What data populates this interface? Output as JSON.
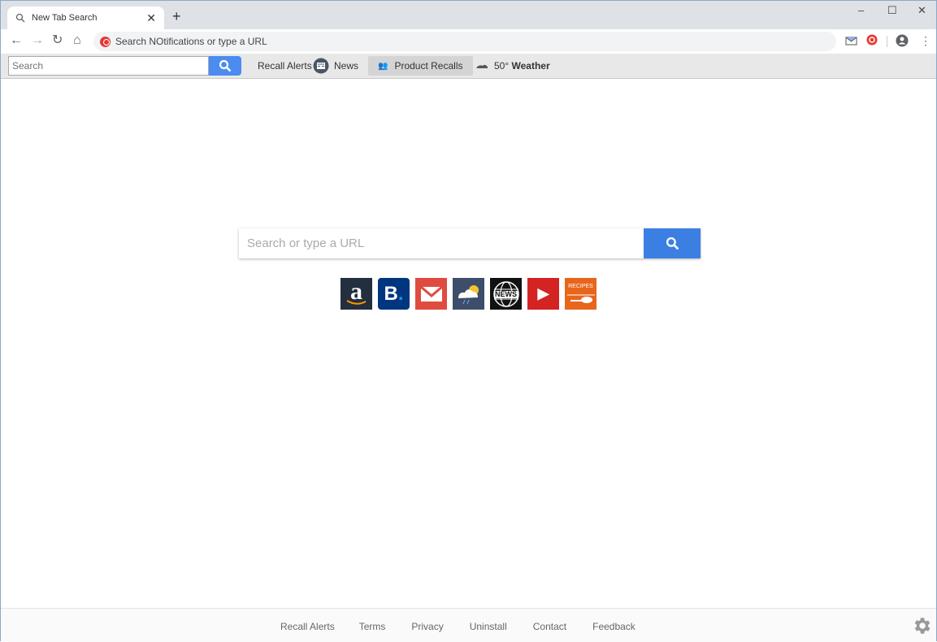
{
  "browser": {
    "tab_title": "New Tab Search",
    "address_placeholder": "Search NOtifications or type a URL",
    "window_controls": {
      "minimize": "–",
      "maximize": "☐",
      "close": "✕"
    }
  },
  "toolbar": {
    "search_placeholder": "Search",
    "links": [
      {
        "label": "Recall Alerts",
        "icon": "none"
      },
      {
        "label": "News",
        "icon": "news-icon"
      },
      {
        "label": "Product Recalls",
        "icon": "people-icon"
      },
      {
        "label": "Weather",
        "temp": "50°",
        "icon": "cloud-icon"
      }
    ]
  },
  "main": {
    "search_placeholder": "Search or type a URL",
    "tiles": [
      {
        "name": "amazon",
        "label": "a",
        "color": "#232f3e"
      },
      {
        "name": "booking",
        "label": "B.",
        "color": "#003580"
      },
      {
        "name": "gmail",
        "label": "M",
        "color": "#e04b3f"
      },
      {
        "name": "weather",
        "label": "weather",
        "color": "#3d4e6b"
      },
      {
        "name": "news",
        "label": "NEWS",
        "color": "#111111"
      },
      {
        "name": "youtube",
        "label": "▶",
        "color": "#d32323"
      },
      {
        "name": "recipes",
        "label": "RECIPES",
        "color": "#e8651c"
      }
    ]
  },
  "footer": {
    "links": [
      "Recall Alerts",
      "Terms",
      "Privacy",
      "Uninstall",
      "Contact",
      "Feedback"
    ]
  },
  "colors": {
    "accent": "#3b7fe3",
    "toolbar_btn": "#4a8cf0"
  }
}
